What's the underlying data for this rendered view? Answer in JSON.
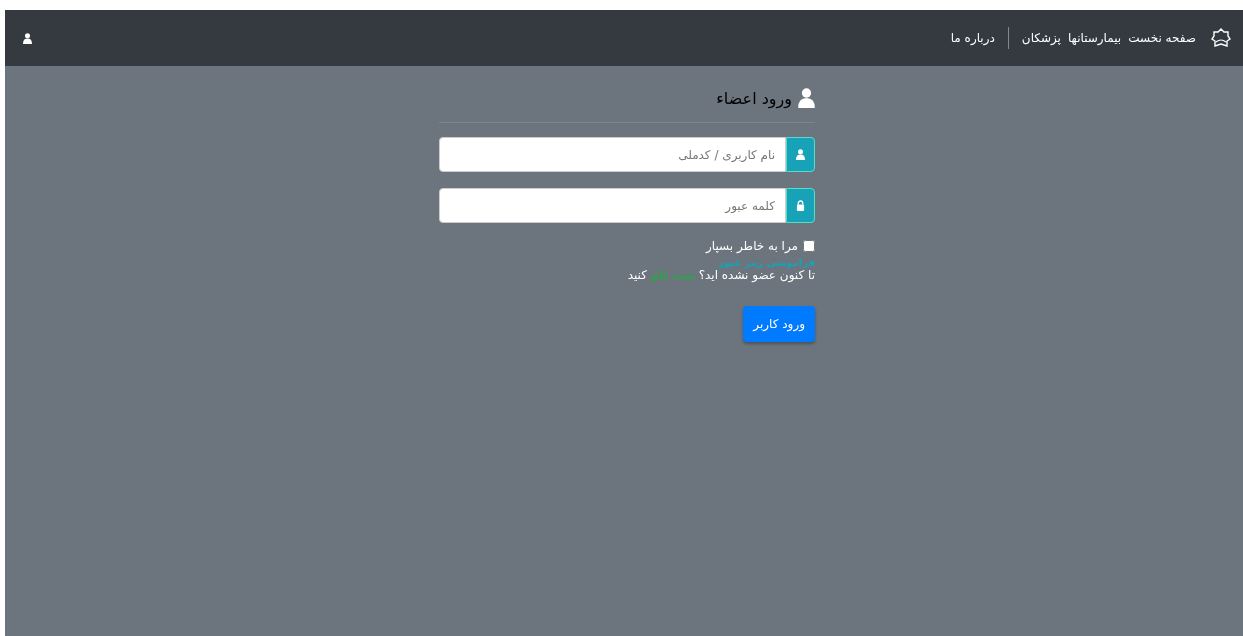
{
  "navbar": {
    "links": [
      {
        "label": "صفحه نخست"
      },
      {
        "label": "بیمارستانها"
      },
      {
        "label": "پزشکان"
      },
      {
        "label": "درباره ما"
      }
    ]
  },
  "login": {
    "title": "ورود اعضاء",
    "fields": [
      {
        "kind": "user",
        "placeholder": "نام کاربری / کدملی"
      },
      {
        "kind": "lock",
        "placeholder": "کلمه عبور"
      }
    ],
    "remember": {
      "label": "مرا به خاطر بسپار",
      "checked": false
    },
    "forgot_link": "فراموشی رمز عبور",
    "register": {
      "before": "تا کنون عضو نشده اید؟",
      "link": "ثبت نام",
      "after": "کنید"
    },
    "submit": "ورود کاربر"
  }
}
